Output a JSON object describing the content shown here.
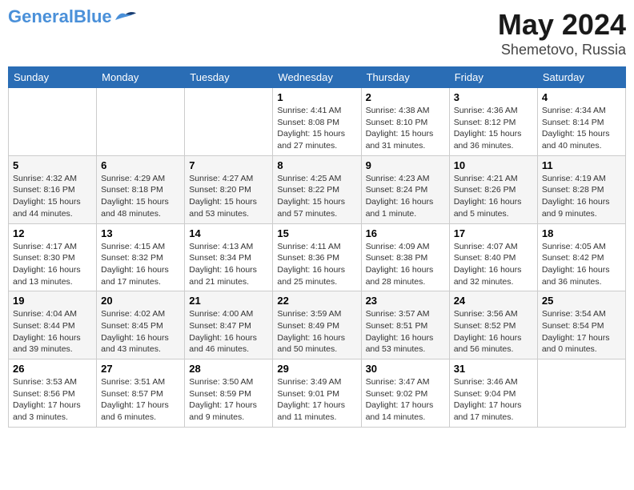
{
  "header": {
    "logo_general": "General",
    "logo_blue": "Blue",
    "title": "May 2024",
    "location": "Shemetovo, Russia"
  },
  "days_of_week": [
    "Sunday",
    "Monday",
    "Tuesday",
    "Wednesday",
    "Thursday",
    "Friday",
    "Saturday"
  ],
  "weeks": [
    [
      {
        "day": "",
        "info": ""
      },
      {
        "day": "",
        "info": ""
      },
      {
        "day": "",
        "info": ""
      },
      {
        "day": "1",
        "info": "Sunrise: 4:41 AM\nSunset: 8:08 PM\nDaylight: 15 hours\nand 27 minutes."
      },
      {
        "day": "2",
        "info": "Sunrise: 4:38 AM\nSunset: 8:10 PM\nDaylight: 15 hours\nand 31 minutes."
      },
      {
        "day": "3",
        "info": "Sunrise: 4:36 AM\nSunset: 8:12 PM\nDaylight: 15 hours\nand 36 minutes."
      },
      {
        "day": "4",
        "info": "Sunrise: 4:34 AM\nSunset: 8:14 PM\nDaylight: 15 hours\nand 40 minutes."
      }
    ],
    [
      {
        "day": "5",
        "info": "Sunrise: 4:32 AM\nSunset: 8:16 PM\nDaylight: 15 hours\nand 44 minutes."
      },
      {
        "day": "6",
        "info": "Sunrise: 4:29 AM\nSunset: 8:18 PM\nDaylight: 15 hours\nand 48 minutes."
      },
      {
        "day": "7",
        "info": "Sunrise: 4:27 AM\nSunset: 8:20 PM\nDaylight: 15 hours\nand 53 minutes."
      },
      {
        "day": "8",
        "info": "Sunrise: 4:25 AM\nSunset: 8:22 PM\nDaylight: 15 hours\nand 57 minutes."
      },
      {
        "day": "9",
        "info": "Sunrise: 4:23 AM\nSunset: 8:24 PM\nDaylight: 16 hours\nand 1 minute."
      },
      {
        "day": "10",
        "info": "Sunrise: 4:21 AM\nSunset: 8:26 PM\nDaylight: 16 hours\nand 5 minutes."
      },
      {
        "day": "11",
        "info": "Sunrise: 4:19 AM\nSunset: 8:28 PM\nDaylight: 16 hours\nand 9 minutes."
      }
    ],
    [
      {
        "day": "12",
        "info": "Sunrise: 4:17 AM\nSunset: 8:30 PM\nDaylight: 16 hours\nand 13 minutes."
      },
      {
        "day": "13",
        "info": "Sunrise: 4:15 AM\nSunset: 8:32 PM\nDaylight: 16 hours\nand 17 minutes."
      },
      {
        "day": "14",
        "info": "Sunrise: 4:13 AM\nSunset: 8:34 PM\nDaylight: 16 hours\nand 21 minutes."
      },
      {
        "day": "15",
        "info": "Sunrise: 4:11 AM\nSunset: 8:36 PM\nDaylight: 16 hours\nand 25 minutes."
      },
      {
        "day": "16",
        "info": "Sunrise: 4:09 AM\nSunset: 8:38 PM\nDaylight: 16 hours\nand 28 minutes."
      },
      {
        "day": "17",
        "info": "Sunrise: 4:07 AM\nSunset: 8:40 PM\nDaylight: 16 hours\nand 32 minutes."
      },
      {
        "day": "18",
        "info": "Sunrise: 4:05 AM\nSunset: 8:42 PM\nDaylight: 16 hours\nand 36 minutes."
      }
    ],
    [
      {
        "day": "19",
        "info": "Sunrise: 4:04 AM\nSunset: 8:44 PM\nDaylight: 16 hours\nand 39 minutes."
      },
      {
        "day": "20",
        "info": "Sunrise: 4:02 AM\nSunset: 8:45 PM\nDaylight: 16 hours\nand 43 minutes."
      },
      {
        "day": "21",
        "info": "Sunrise: 4:00 AM\nSunset: 8:47 PM\nDaylight: 16 hours\nand 46 minutes."
      },
      {
        "day": "22",
        "info": "Sunrise: 3:59 AM\nSunset: 8:49 PM\nDaylight: 16 hours\nand 50 minutes."
      },
      {
        "day": "23",
        "info": "Sunrise: 3:57 AM\nSunset: 8:51 PM\nDaylight: 16 hours\nand 53 minutes."
      },
      {
        "day": "24",
        "info": "Sunrise: 3:56 AM\nSunset: 8:52 PM\nDaylight: 16 hours\nand 56 minutes."
      },
      {
        "day": "25",
        "info": "Sunrise: 3:54 AM\nSunset: 8:54 PM\nDaylight: 17 hours\nand 0 minutes."
      }
    ],
    [
      {
        "day": "26",
        "info": "Sunrise: 3:53 AM\nSunset: 8:56 PM\nDaylight: 17 hours\nand 3 minutes."
      },
      {
        "day": "27",
        "info": "Sunrise: 3:51 AM\nSunset: 8:57 PM\nDaylight: 17 hours\nand 6 minutes."
      },
      {
        "day": "28",
        "info": "Sunrise: 3:50 AM\nSunset: 8:59 PM\nDaylight: 17 hours\nand 9 minutes."
      },
      {
        "day": "29",
        "info": "Sunrise: 3:49 AM\nSunset: 9:01 PM\nDaylight: 17 hours\nand 11 minutes."
      },
      {
        "day": "30",
        "info": "Sunrise: 3:47 AM\nSunset: 9:02 PM\nDaylight: 17 hours\nand 14 minutes."
      },
      {
        "day": "31",
        "info": "Sunrise: 3:46 AM\nSunset: 9:04 PM\nDaylight: 17 hours\nand 17 minutes."
      },
      {
        "day": "",
        "info": ""
      }
    ]
  ]
}
